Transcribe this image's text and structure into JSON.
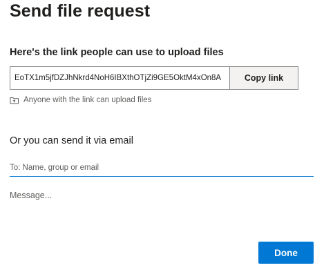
{
  "dialog": {
    "title": "Send file request"
  },
  "link_section": {
    "heading": "Here's the link people can use to upload files",
    "link_value": "EoTX1m5jfDZJhNkrd4NoH6IBXthOTjZi9GE5OktM4xOn8A",
    "copy_button_label": "Copy link",
    "permission_icon": "folder-upload-icon",
    "permission_text": "Anyone with the link can upload files"
  },
  "email_section": {
    "heading": "Or you can send it via email",
    "to_value": "",
    "to_placeholder": "To: Name, group or email",
    "message_value": "",
    "message_placeholder": "Message..."
  },
  "footer": {
    "done_button_label": "Done"
  },
  "colors": {
    "accent": "#0078d4",
    "text": "#201f1e",
    "secondary_text": "#605e5c",
    "border": "#8a8886",
    "button_bg": "#f3f2f1"
  }
}
